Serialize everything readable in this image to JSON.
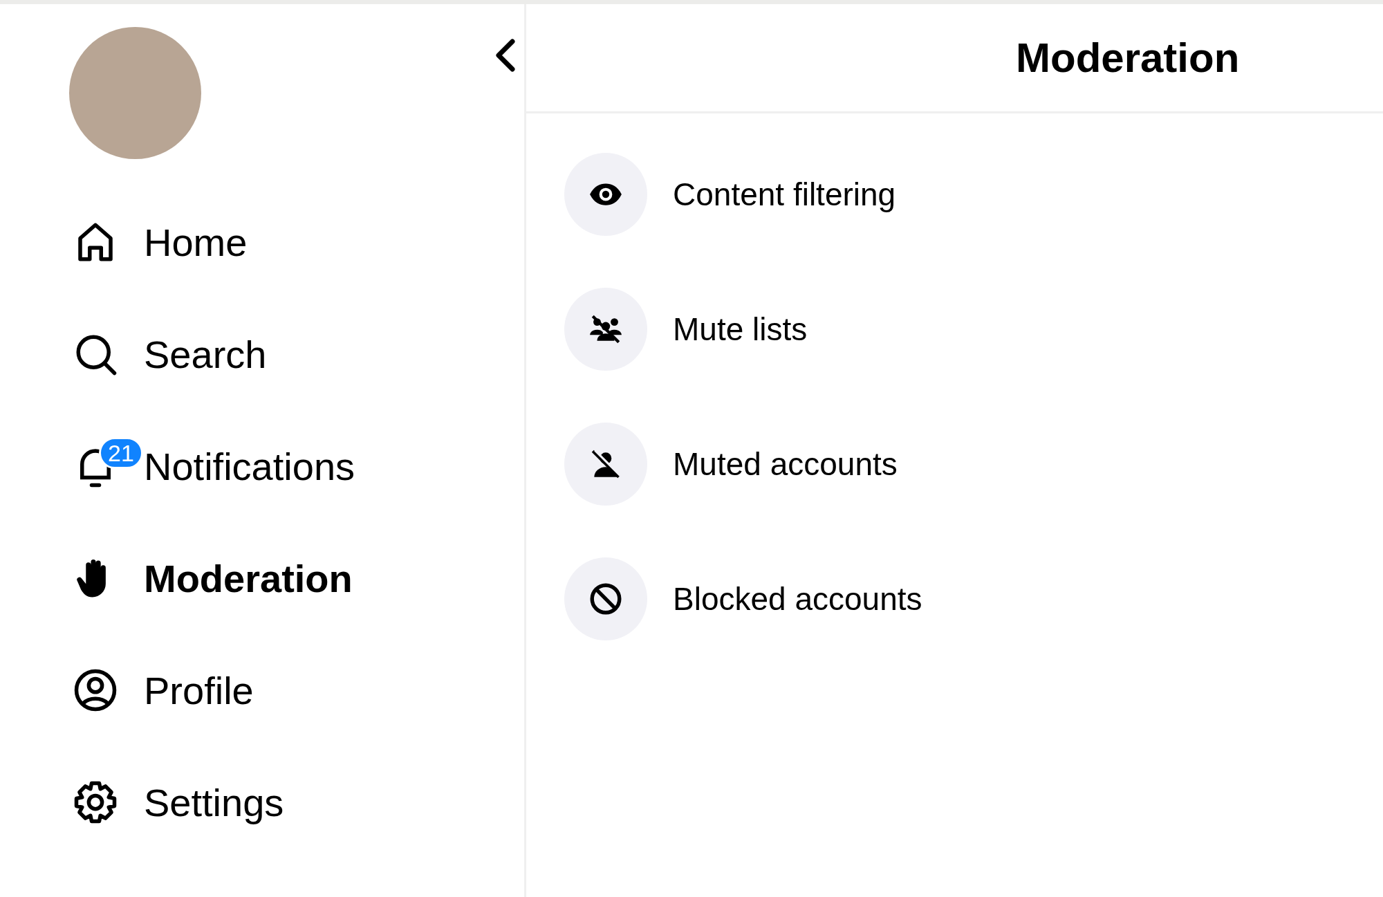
{
  "sidebar": {
    "items": [
      {
        "kind": "home",
        "label": "Home",
        "selected": false
      },
      {
        "kind": "search",
        "label": "Search",
        "selected": false
      },
      {
        "kind": "bell",
        "label": "Notifications",
        "selected": false,
        "badge": "21"
      },
      {
        "kind": "hand",
        "label": "Moderation",
        "selected": true
      },
      {
        "kind": "profile",
        "label": "Profile",
        "selected": false
      },
      {
        "kind": "gear",
        "label": "Settings",
        "selected": false
      }
    ]
  },
  "page": {
    "title": "Moderation",
    "items": [
      {
        "kind": "eye",
        "label": "Content filtering"
      },
      {
        "kind": "group",
        "label": "Mute lists"
      },
      {
        "kind": "person-off",
        "label": "Muted accounts"
      },
      {
        "kind": "block",
        "label": "Blocked accounts"
      }
    ]
  }
}
